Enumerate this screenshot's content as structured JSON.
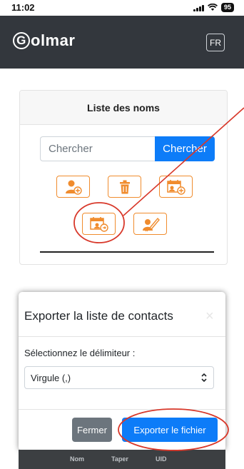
{
  "status_bar": {
    "time": "11:02",
    "battery": "95"
  },
  "navbar": {
    "brand": "olmar",
    "brand_initial": "G",
    "lang": "FR"
  },
  "names_card": {
    "title": "Liste des noms",
    "search_placeholder": "Chercher",
    "search_button": "Chercher",
    "actions": [
      {
        "name": "add-user",
        "icon": "user-plus-icon"
      },
      {
        "name": "delete",
        "icon": "trash-icon"
      },
      {
        "name": "import-calendar",
        "icon": "calendar-add-icon"
      },
      {
        "name": "export-calendar",
        "icon": "calendar-user-icon"
      },
      {
        "name": "edit-user",
        "icon": "user-edit-icon"
      }
    ]
  },
  "export_modal": {
    "title": "Exporter la liste de contacts",
    "close_symbol": "×",
    "delimiter_label": "Sélectionnez le délimiteur :",
    "delimiter_value": "Virgule (,)",
    "close_button": "Fermer",
    "export_button": "Exporter le fichier"
  },
  "background_table": {
    "columns": [
      "Nom",
      "Taper",
      "UID"
    ]
  },
  "colors": {
    "navbar": "#33373d",
    "accent": "#0d7cf8",
    "action_border": "#f08c2e",
    "annotation": "#d8382a"
  }
}
